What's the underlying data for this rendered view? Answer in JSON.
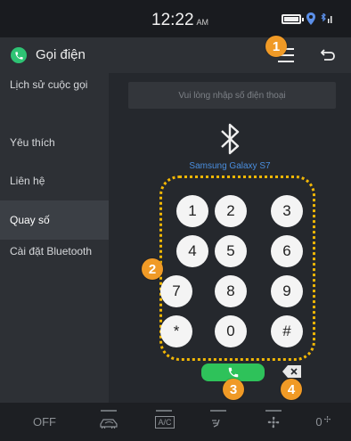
{
  "status": {
    "time": "12:22",
    "ampm": "AM",
    "icons": [
      "battery-icon",
      "location-icon",
      "bluetooth-signal-icon"
    ]
  },
  "header": {
    "title": "Gọi điện",
    "icon": "phone-icon",
    "menu_icon": "hamburger-menu-icon",
    "back_icon": "back-arrow-icon"
  },
  "sidebar": {
    "items": [
      {
        "label": "Lịch sử cuộc gọi",
        "active": false
      },
      {
        "label": "Yêu thích",
        "active": false
      },
      {
        "label": "Liên hệ",
        "active": false
      },
      {
        "label": "Quay số",
        "active": true
      },
      {
        "label": "Cài đặt Bluetooth",
        "active": false
      }
    ]
  },
  "dialer": {
    "input_placeholder": "Vui lòng nhập số điện thoại",
    "input_value": "",
    "device_name": "Samsung Galaxy S7",
    "keys": [
      "1",
      "2",
      "3",
      "4",
      "5",
      "6",
      "7",
      "8",
      "9",
      "*",
      "0",
      "#"
    ],
    "call_icon": "phone-call-icon",
    "delete_icon": "backspace-icon"
  },
  "callouts": [
    "1",
    "2",
    "3",
    "4"
  ],
  "bottom_bar": {
    "off_label": "OFF",
    "ac_label": "A/C",
    "temp_label": "0",
    "icons": [
      "car-recirculation-icon",
      "ac-icon",
      "seat-airflow-icon",
      "fan-icon",
      "fan-speed-icon"
    ]
  },
  "colors": {
    "accent_yellow": "#f2b705",
    "callout_orange": "#f09a26",
    "call_green": "#2ec25a",
    "device_blue": "#4a8ede"
  }
}
